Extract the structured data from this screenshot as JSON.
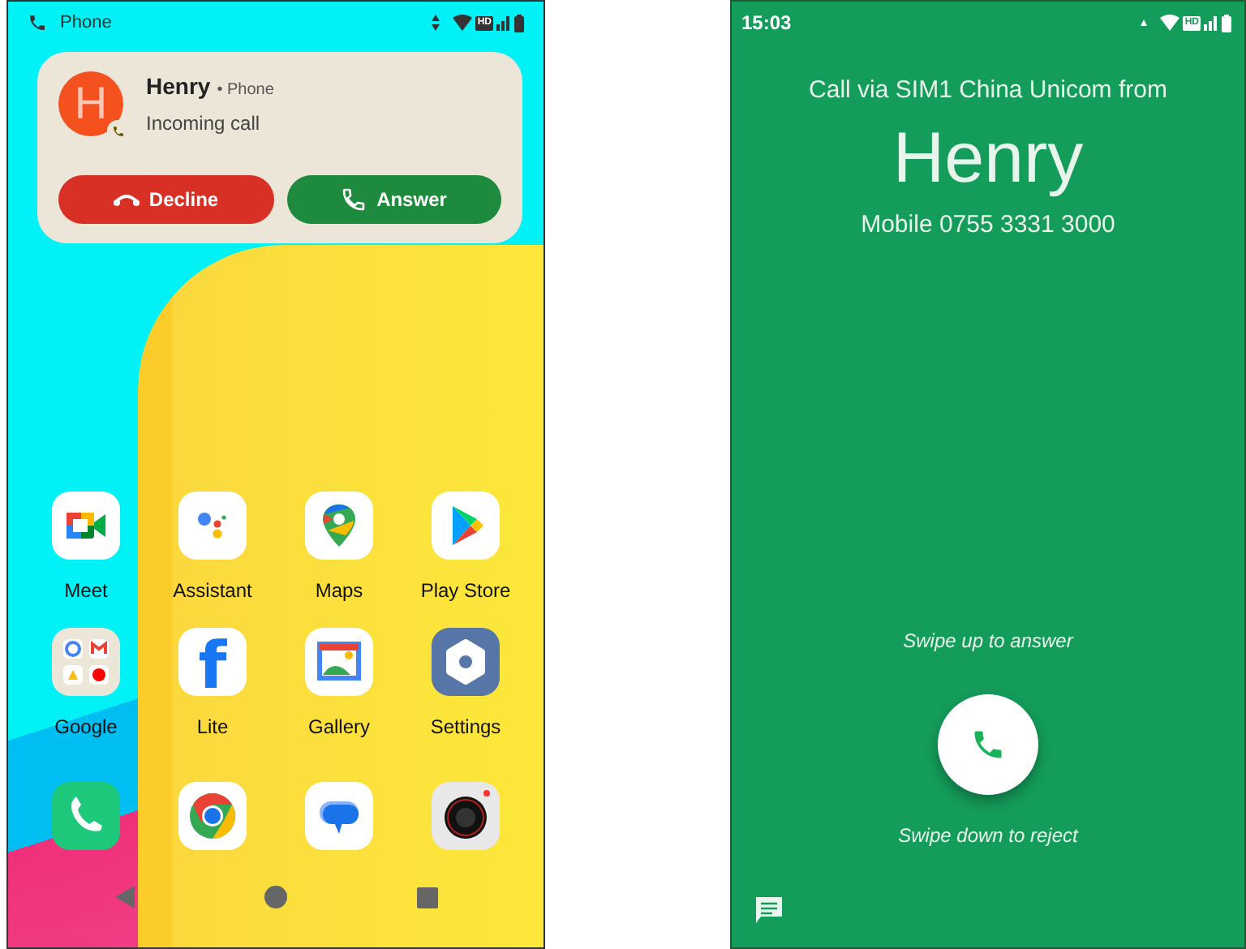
{
  "home_screen": {
    "status_bar": {
      "app_label": "Phone",
      "hd_badge": "HD"
    },
    "notification": {
      "avatar_letter": "H",
      "caller": "Henry",
      "source": "• Phone",
      "message": "Incoming call",
      "actions": [
        {
          "kind": "decline",
          "label": "Decline"
        },
        {
          "kind": "answer",
          "label": "Answer"
        }
      ]
    },
    "apps": [
      {
        "label": "Meet"
      },
      {
        "label": "Assistant"
      },
      {
        "label": "Maps"
      },
      {
        "label": "Play Store"
      },
      {
        "label": "Google"
      },
      {
        "label": "Lite",
        "glyph": "f"
      },
      {
        "label": "Gallery"
      },
      {
        "label": "Settings"
      }
    ]
  },
  "call_screen": {
    "status_bar": {
      "time": "15:03",
      "hd_badge": "HD"
    },
    "via": "Call via SIM1 China Unicom from",
    "caller": "Henry",
    "number": "Mobile 0755 3331 3000",
    "swipe_up_hint": "Swipe up to answer",
    "swipe_down_hint": "Swipe down to reject"
  }
}
